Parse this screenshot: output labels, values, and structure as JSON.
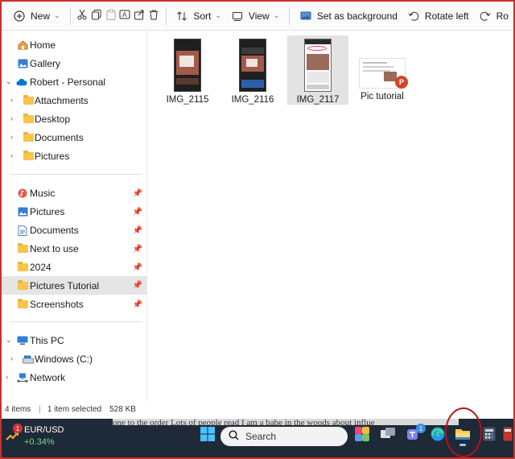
{
  "toolbar": {
    "new_label": "New",
    "sort_label": "Sort",
    "view_label": "View",
    "set_background_label": "Set as background",
    "rotate_left_label": "Rotate left",
    "rotate_right_label": "Ro"
  },
  "sidebar": {
    "home": "Home",
    "gallery": "Gallery",
    "account": "Robert - Personal",
    "account_children": [
      "Attachments",
      "Desktop",
      "Documents",
      "Pictures"
    ],
    "quick_access": [
      {
        "label": "Music",
        "icon": "music-icon"
      },
      {
        "label": "Pictures",
        "icon": "pictures-icon"
      },
      {
        "label": "Documents",
        "icon": "documents-icon"
      },
      {
        "label": "Next to use",
        "icon": "folder-icon"
      },
      {
        "label": "2024",
        "icon": "folder-icon"
      },
      {
        "label": "Pictures Tutorial",
        "icon": "folder-icon"
      },
      {
        "label": "Screenshots",
        "icon": "folder-icon"
      }
    ],
    "this_pc": "This PC",
    "drive_c": "Windows (C:)",
    "network": "Network"
  },
  "files": [
    {
      "name": "IMG_2115",
      "selected": false
    },
    {
      "name": "IMG_2116",
      "selected": false
    },
    {
      "name": "IMG_2117",
      "selected": true
    },
    {
      "name": "Pic tutorial",
      "selected": false
    }
  ],
  "status": {
    "items_count": "4 items",
    "selection": "1 item selected",
    "size": "528 KB"
  },
  "taskbar": {
    "ticker_pair": "EUR/USD",
    "ticker_change": "+0.34%",
    "weather_badge": "1",
    "search_label": "Search",
    "teams_badge": "1"
  },
  "background_text": "one to the order   Lots of people read   I am a babe in the woods about   influe",
  "colors": {
    "accent": "#0067c0",
    "selected_bg": "#e5e5e5",
    "folder": "#f7c54b",
    "taskbar": "#1e2a38",
    "annotation_red": "#b3131b"
  }
}
